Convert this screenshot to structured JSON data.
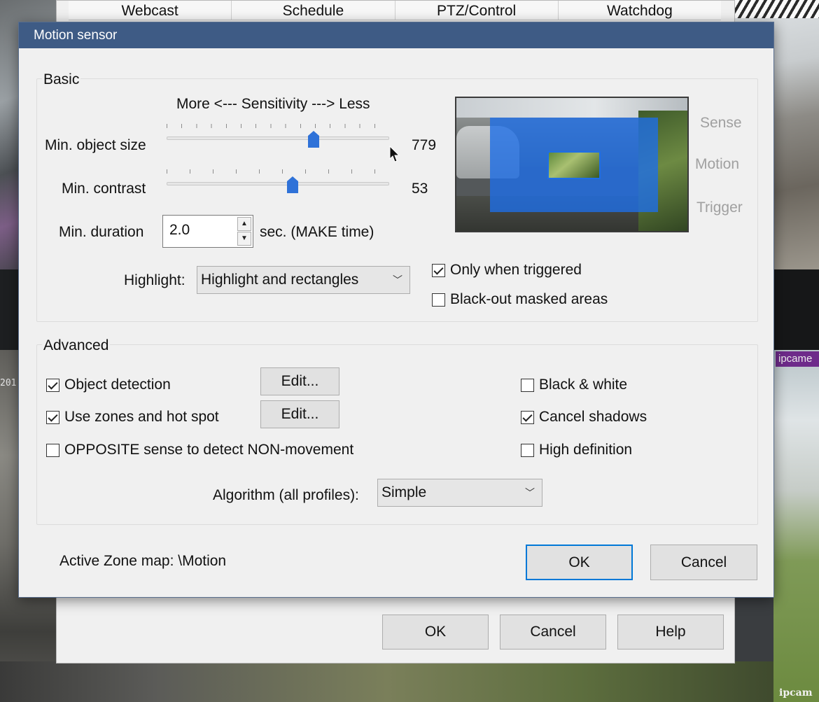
{
  "background": {
    "cam_label": "ipcame",
    "cam_stamp": "ipcam",
    "left_stamp": "201"
  },
  "parent": {
    "tabs": [
      "Webcast",
      "Schedule",
      "PTZ/Control",
      "Watchdog"
    ],
    "ok_label": "OK",
    "cancel_label": "Cancel",
    "help_label": "Help"
  },
  "dialog": {
    "title": "Motion sensor",
    "basic": {
      "title": "Basic",
      "sensitivity_caption": "More <--- Sensitivity ---> Less",
      "min_object_size_label": "Min. object size",
      "min_object_size_value": "779",
      "min_object_size_fraction": 0.67,
      "min_contrast_label": "Min. contrast",
      "min_contrast_value": "53",
      "min_contrast_fraction": 0.57,
      "min_duration_label": "Min. duration",
      "min_duration_value": "2.0",
      "min_duration_unit": "sec.  (MAKE time)",
      "highlight_label": "Highlight:",
      "highlight_value": "Highlight and rectangles",
      "only_when_triggered": {
        "label": "Only when triggered",
        "checked": true
      },
      "black_out_masked": {
        "label": "Black-out masked areas",
        "checked": false
      },
      "preview_labels": [
        "Sense",
        "Motion",
        "Trigger"
      ]
    },
    "advanced": {
      "title": "Advanced",
      "object_detection": {
        "label": "Object detection",
        "checked": true
      },
      "use_zones": {
        "label": "Use zones and hot spot",
        "checked": true
      },
      "opposite_sense": {
        "label": "OPPOSITE sense to detect NON-movement",
        "checked": false
      },
      "edit_label": "Edit...",
      "black_white": {
        "label": "Black & white",
        "checked": false
      },
      "cancel_shadows": {
        "label": "Cancel shadows",
        "checked": true
      },
      "high_definition": {
        "label": "High definition",
        "checked": false
      },
      "algorithm_label": "Algorithm (all profiles):",
      "algorithm_value": "Simple"
    },
    "active_zone_label": "Active Zone map:  \\Motion",
    "ok_label": "OK",
    "cancel_label": "Cancel"
  },
  "colors": {
    "titlebar": "#3e5b85",
    "accent": "#0078d7",
    "slider_thumb": "#2f72d8",
    "zone_overlay": "#1e6ee6"
  }
}
